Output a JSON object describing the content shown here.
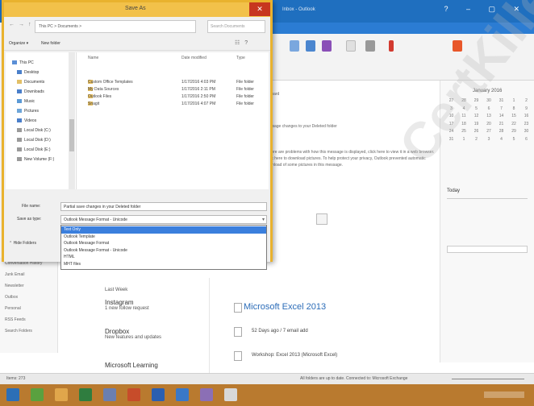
{
  "outlook": {
    "title": "Inbox - Outlook",
    "cal_month": "January 2016",
    "cal_days": [
      [
        "27",
        "28",
        "29",
        "30",
        "31",
        "1",
        "2"
      ],
      [
        "3",
        "4",
        "5",
        "6",
        "7",
        "8",
        "9"
      ],
      [
        "10",
        "11",
        "12",
        "13",
        "14",
        "15",
        "16"
      ],
      [
        "17",
        "18",
        "19",
        "20",
        "21",
        "22",
        "23"
      ],
      [
        "24",
        "25",
        "26",
        "27",
        "28",
        "29",
        "30"
      ],
      [
        "31",
        "1",
        "2",
        "3",
        "4",
        "5",
        "6"
      ]
    ],
    "today_label": "Today",
    "reading_lines": [
      "Forward",
      "message changes to your Deleted folder",
      "If there are problems with how this message is displayed, click here to view it in a web browser.",
      "Click here to download pictures. To help protect your privacy, Outlook prevented automatic",
      "download of some pictures in this message."
    ],
    "excel_title": "Microsoft Excel 2013",
    "reading_items": [
      "52 Days ago / 7 email add",
      "Workshop: Excel 2013 (Microsoft Excel)"
    ],
    "msg_group": "Last Week",
    "messages": [
      {
        "sender": "Instagram",
        "preview": "1 new follow request"
      },
      {
        "sender": "Dropbox",
        "preview": "New features and updates"
      },
      {
        "sender": "Microsoft Learning",
        "preview": ""
      }
    ],
    "status_left": "Items: 273",
    "status_right": "All folders are up to date.   Connected to: Microsoft Exchange",
    "folder_nav": [
      "Conversation History",
      "Junk Email",
      "Newsletter",
      "Outbox",
      "Personal",
      "RSS Feeds",
      "Search Folders"
    ]
  },
  "watermark": "CertKiller",
  "dialog": {
    "title": "Save As",
    "close_glyph": "✕",
    "address": "This PC  >  Documents  >",
    "search_placeholder": "Search Documents",
    "organize_label": "Organize ▾",
    "new_folder_label": "New folder",
    "nav_items": [
      "This PC",
      "Desktop",
      "Documents",
      "Downloads",
      "Music",
      "Pictures",
      "Videos",
      "Local Disk (C:)",
      "Local Disk (D:)",
      "Local Disk (E:)",
      "New Volume (F:)"
    ],
    "columns": [
      "Name",
      "Date modified",
      "Type"
    ],
    "files": [
      {
        "name": "Custom Office Templates",
        "date": "1/17/2016 4:03 PM",
        "type": "File folder"
      },
      {
        "name": "My Data Sources",
        "date": "1/17/2016 2:11 PM",
        "type": "File folder"
      },
      {
        "name": "Outlook Files",
        "date": "1/17/2016 2:50 PM",
        "type": "File folder"
      },
      {
        "name": "Snagit",
        "date": "1/17/2016 4:07 PM",
        "type": "File folder"
      }
    ],
    "file_name_label": "File name:",
    "file_name_value": "Partial save changes in your Deleted folder",
    "save_type_label": "Save as type:",
    "save_type_value": "Outlook Message Format - Unicode",
    "type_options": [
      "Text Only",
      "Outlook Template",
      "Outlook Message Format",
      "Outlook Message Format - Unicode",
      "HTML",
      "MHT files"
    ],
    "selected_option": 0,
    "hide_folders_label": "Hide Folders"
  }
}
